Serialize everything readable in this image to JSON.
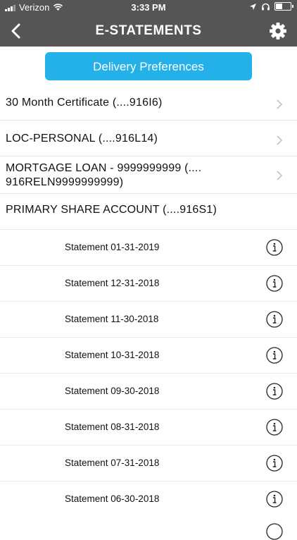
{
  "status_bar": {
    "carrier": "Verizon",
    "time": "3:33 PM"
  },
  "nav": {
    "title": "E-STATEMENTS",
    "back_icon": "chevron-left-icon",
    "settings_icon": "gear-icon"
  },
  "delivery_button_label": "Delivery Preferences",
  "accounts": [
    {
      "line1": "30 Month Certificate  (....916I6)",
      "line2": ""
    },
    {
      "line1": "LOC-PERSONAL  (....916L14)",
      "line2": ""
    },
    {
      "line1": "MORTGAGE LOAN - 9999999999  (....",
      "line2": "916RELN9999999999)"
    },
    {
      "line1": "PRIMARY SHARE ACCOUNT  (....916S1)",
      "line2": ""
    }
  ],
  "statements": [
    "Statement 01-31-2019",
    "Statement 12-31-2018",
    "Statement 11-30-2018",
    "Statement 10-31-2018",
    "Statement 09-30-2018",
    "Statement 08-31-2018",
    "Statement 07-31-2018",
    "Statement 06-30-2018"
  ]
}
